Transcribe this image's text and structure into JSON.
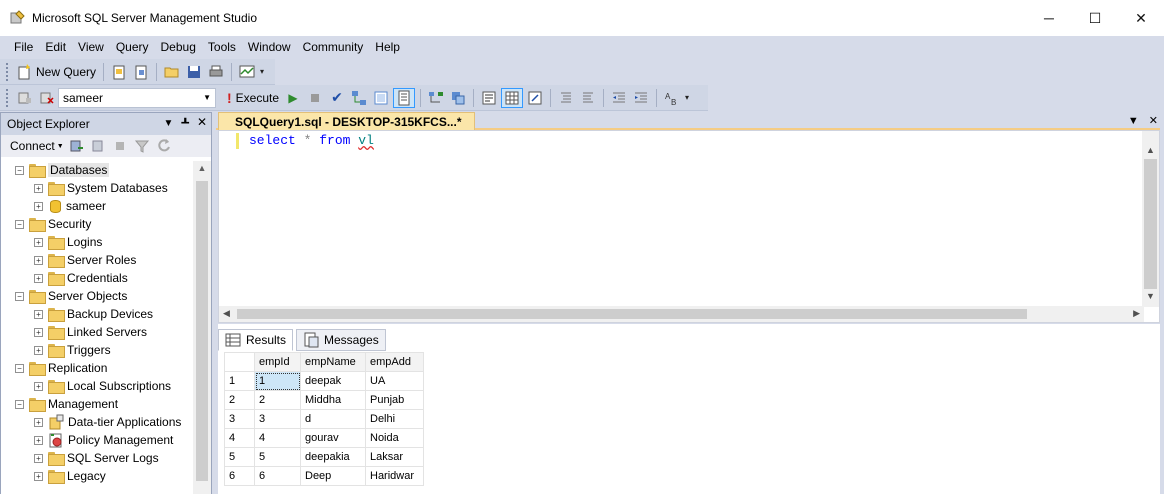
{
  "window": {
    "title": "Microsoft SQL Server Management Studio",
    "minimize": "─",
    "maximize": "☐",
    "close": "✕"
  },
  "menu": [
    "File",
    "Edit",
    "View",
    "Query",
    "Debug",
    "Tools",
    "Window",
    "Community",
    "Help"
  ],
  "toolbar1": {
    "new_query": "New Query"
  },
  "toolbar2": {
    "database": "sameer",
    "execute": "Execute"
  },
  "object_explorer": {
    "title": "Object Explorer",
    "connect": "Connect",
    "tree": [
      {
        "label": "Databases",
        "level": 0,
        "icon": "folder-icon",
        "expander": "−",
        "selected": true
      },
      {
        "label": "System Databases",
        "level": 1,
        "icon": "folder-icon",
        "expander": "+"
      },
      {
        "label": "sameer",
        "level": 1,
        "icon": "database-icon",
        "expander": "+"
      },
      {
        "label": "Security",
        "level": 0,
        "icon": "folder-icon",
        "expander": "−"
      },
      {
        "label": "Logins",
        "level": 1,
        "icon": "folder-icon",
        "expander": "+"
      },
      {
        "label": "Server Roles",
        "level": 1,
        "icon": "folder-icon",
        "expander": "+"
      },
      {
        "label": "Credentials",
        "level": 1,
        "icon": "folder-icon",
        "expander": "+"
      },
      {
        "label": "Server Objects",
        "level": 0,
        "icon": "folder-icon",
        "expander": "−"
      },
      {
        "label": "Backup Devices",
        "level": 1,
        "icon": "folder-icon",
        "expander": "+"
      },
      {
        "label": "Linked Servers",
        "level": 1,
        "icon": "folder-icon",
        "expander": "+"
      },
      {
        "label": "Triggers",
        "level": 1,
        "icon": "folder-icon",
        "expander": "+"
      },
      {
        "label": "Replication",
        "level": 0,
        "icon": "folder-icon",
        "expander": "−"
      },
      {
        "label": "Local Subscriptions",
        "level": 1,
        "icon": "folder-icon",
        "expander": "+"
      },
      {
        "label": "Management",
        "level": 0,
        "icon": "folder-icon",
        "expander": "−"
      },
      {
        "label": "Data-tier Applications",
        "level": 1,
        "icon": "data-tier-icon",
        "expander": "+"
      },
      {
        "label": "Policy Management",
        "level": 1,
        "icon": "policy-icon",
        "expander": "+"
      },
      {
        "label": "SQL Server Logs",
        "level": 1,
        "icon": "folder-icon",
        "expander": "+"
      },
      {
        "label": "Legacy",
        "level": 1,
        "icon": "folder-icon",
        "expander": "+"
      }
    ]
  },
  "editor": {
    "tab_title": "SQLQuery1.sql - DESKTOP-315KFCS...*",
    "code": {
      "kw1": "select",
      "op": "*",
      "kw2": "from",
      "table": "vl"
    }
  },
  "results": {
    "tabs": [
      "Results",
      "Messages"
    ],
    "columns": [
      "empId",
      "empName",
      "empAdd"
    ],
    "rows": [
      [
        "1",
        "1",
        "deepak",
        "UA"
      ],
      [
        "2",
        "2",
        "Middha",
        "Punjab"
      ],
      [
        "3",
        "3",
        "d",
        "Delhi"
      ],
      [
        "4",
        "4",
        "gourav",
        "Noida"
      ],
      [
        "5",
        "5",
        "deepakia",
        "Laksar"
      ],
      [
        "6",
        "6",
        "Deep",
        "Haridwar"
      ]
    ]
  }
}
